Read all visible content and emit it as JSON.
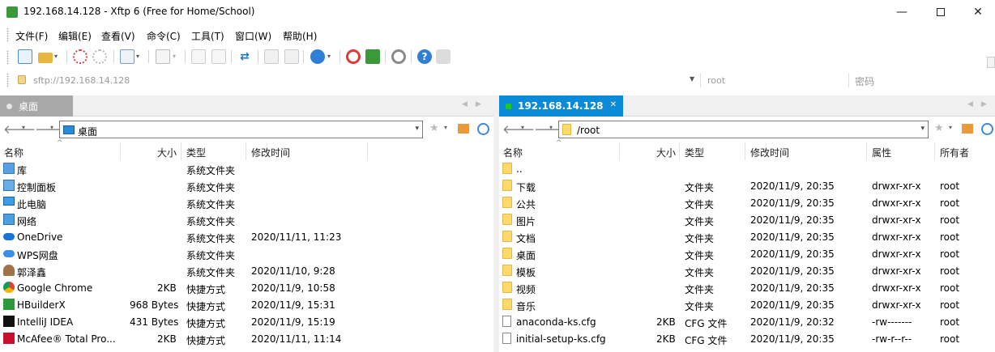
{
  "window": {
    "title": "192.168.14.128 - Xftp 6 (Free for Home/School)"
  },
  "menu": [
    "文件(F)",
    "编辑(E)",
    "查看(V)",
    "命令(C)",
    "工具(T)",
    "窗口(W)",
    "帮助(H)"
  ],
  "address": {
    "host": "sftp://192.168.14.128",
    "user": "root",
    "password_placeholder": "密码"
  },
  "left": {
    "tab": "桌面",
    "path": "桌面",
    "columns": [
      "名称",
      "大小",
      "类型",
      "修改时间"
    ],
    "rows": [
      {
        "name": "库",
        "size": "",
        "type": "系统文件夹",
        "modified": "",
        "icon": "library-icon"
      },
      {
        "name": "控制面板",
        "size": "",
        "type": "系统文件夹",
        "modified": "",
        "icon": "control-panel-icon"
      },
      {
        "name": "此电脑",
        "size": "",
        "type": "系统文件夹",
        "modified": "",
        "icon": "computer-icon"
      },
      {
        "name": "网络",
        "size": "",
        "type": "系统文件夹",
        "modified": "",
        "icon": "network-icon"
      },
      {
        "name": "OneDrive",
        "size": "",
        "type": "系统文件夹",
        "modified": "2020/11/11, 11:23",
        "icon": "onedrive-icon"
      },
      {
        "name": "WPS网盘",
        "size": "",
        "type": "系统文件夹",
        "modified": "",
        "icon": "cloud-icon"
      },
      {
        "name": "郭泽鑫",
        "size": "",
        "type": "系统文件夹",
        "modified": "2020/11/10, 9:28",
        "icon": "user-icon"
      },
      {
        "name": "Google Chrome",
        "size": "2KB",
        "type": "快捷方式",
        "modified": "2020/11/9, 10:58",
        "icon": "chrome-icon"
      },
      {
        "name": "HBuilderX",
        "size": "968 Bytes",
        "type": "快捷方式",
        "modified": "2020/11/9, 15:31",
        "icon": "hbuilder-icon"
      },
      {
        "name": "IntelliJ IDEA",
        "size": "431 Bytes",
        "type": "快捷方式",
        "modified": "2020/11/9, 15:19",
        "icon": "intellij-icon"
      },
      {
        "name": "McAfee® Total Pro...",
        "size": "2KB",
        "type": "快捷方式",
        "modified": "2020/11/11, 11:14",
        "icon": "mcafee-icon"
      }
    ]
  },
  "right": {
    "tab": "192.168.14.128",
    "path": "/root",
    "columns": [
      "名称",
      "大小",
      "类型",
      "修改时间",
      "属性",
      "所有者"
    ],
    "rows": [
      {
        "name": "..",
        "size": "",
        "type": "",
        "modified": "",
        "attr": "",
        "owner": "",
        "icon": "folder-icon"
      },
      {
        "name": "下载",
        "size": "",
        "type": "文件夹",
        "modified": "2020/11/9, 20:35",
        "attr": "drwxr-xr-x",
        "owner": "root",
        "icon": "folder-icon"
      },
      {
        "name": "公共",
        "size": "",
        "type": "文件夹",
        "modified": "2020/11/9, 20:35",
        "attr": "drwxr-xr-x",
        "owner": "root",
        "icon": "folder-icon"
      },
      {
        "name": "图片",
        "size": "",
        "type": "文件夹",
        "modified": "2020/11/9, 20:35",
        "attr": "drwxr-xr-x",
        "owner": "root",
        "icon": "folder-icon"
      },
      {
        "name": "文档",
        "size": "",
        "type": "文件夹",
        "modified": "2020/11/9, 20:35",
        "attr": "drwxr-xr-x",
        "owner": "root",
        "icon": "folder-icon"
      },
      {
        "name": "桌面",
        "size": "",
        "type": "文件夹",
        "modified": "2020/11/9, 20:35",
        "attr": "drwxr-xr-x",
        "owner": "root",
        "icon": "folder-icon"
      },
      {
        "name": "模板",
        "size": "",
        "type": "文件夹",
        "modified": "2020/11/9, 20:35",
        "attr": "drwxr-xr-x",
        "owner": "root",
        "icon": "folder-icon"
      },
      {
        "name": "视频",
        "size": "",
        "type": "文件夹",
        "modified": "2020/11/9, 20:35",
        "attr": "drwxr-xr-x",
        "owner": "root",
        "icon": "folder-icon"
      },
      {
        "name": "音乐",
        "size": "",
        "type": "文件夹",
        "modified": "2020/11/9, 20:35",
        "attr": "drwxr-xr-x",
        "owner": "root",
        "icon": "folder-icon"
      },
      {
        "name": "anaconda-ks.cfg",
        "size": "2KB",
        "type": "CFG 文件",
        "modified": "2020/11/9, 20:32",
        "attr": "-rw-------",
        "owner": "root",
        "icon": "file-icon"
      },
      {
        "name": "initial-setup-ks.cfg",
        "size": "2KB",
        "type": "CFG 文件",
        "modified": "2020/11/9, 20:35",
        "attr": "-rw-r--r--",
        "owner": "root",
        "icon": "file-icon"
      }
    ]
  },
  "colors": {
    "active_tab": "#0a8ad7",
    "inactive_tab": "#a8a8a8",
    "folder": "#ffd969",
    "connected_dot": "#1fc91f"
  }
}
